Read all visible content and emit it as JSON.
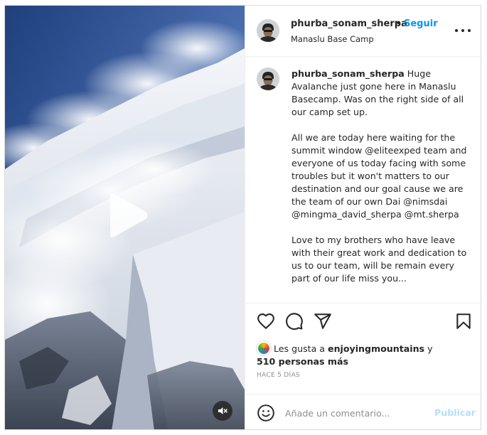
{
  "post": {
    "author": "phurba_sonam_sherpa",
    "dot": "•",
    "follow_label": "Seguir",
    "location": "Manaslu Base Camp",
    "caption_paragraphs": [
      "Huge Avalanche just gone here in Manaslu Basecamp. Was on the right side of all our camp set up.",
      "All we are today here waiting for the summit window @eliteexped team and everyone of us today facing with some troubles but it won't matters to our destination and our goal cause we are the team of our own Dai @nimsdai @mingma_david_sherpa @mt.sherpa",
      "Love to my brothers who have leave with their great work and dedication to us to our team, will be remain every part of our life miss you..."
    ],
    "likes": {
      "prefix": "Les gusta a",
      "user": "enjoyingmountains",
      "connector": "y",
      "others": "510 personas más"
    },
    "time_ago": "HACE 5 DÍAS",
    "comment": {
      "placeholder": "Añade un comentario...",
      "publish_label": "Publicar"
    }
  },
  "icons": {
    "options": "more-options-icon",
    "like": "heart-icon",
    "comment": "comment-bubble-icon",
    "share": "paper-plane-icon",
    "save": "bookmark-icon",
    "emoji": "smiley-icon",
    "play": "play-icon",
    "mute": "speaker-muted-icon"
  },
  "colors": {
    "follow": "#0095f6",
    "publish_disabled": "#b2dffc",
    "text": "#262626",
    "muted": "#8e8e8e",
    "divider": "#efefef"
  }
}
